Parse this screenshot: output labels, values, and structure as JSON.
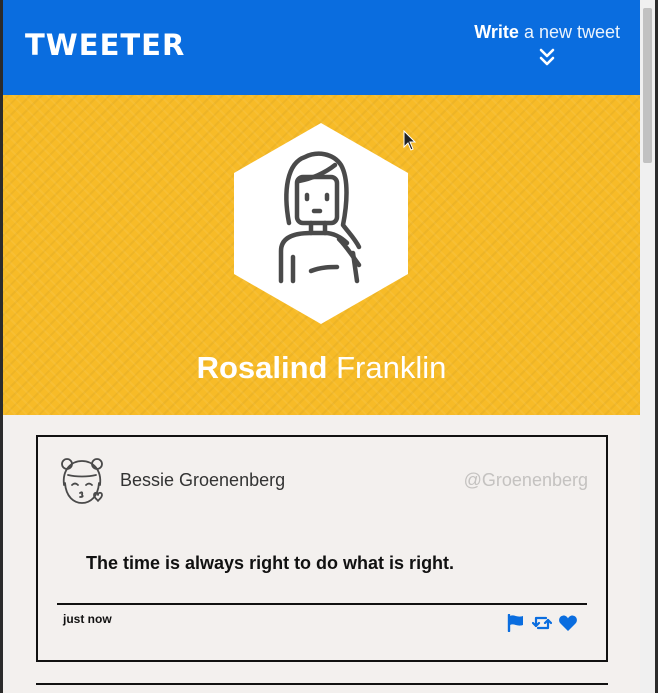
{
  "navbar": {
    "brand": "TWEETER",
    "compose_bold": "Write",
    "compose_rest": "a new tweet",
    "icon": "double-chevron-down-icon"
  },
  "profile": {
    "first_name": "Rosalind",
    "last_name": "Franklin",
    "avatar_icon": "woman-avatar-icon",
    "background_color": "#f7bb27"
  },
  "tweet": {
    "author": "Bessie Groenenberg",
    "handle": "@Groenenberg",
    "avatar_icon": "kissing-girl-avatar-icon",
    "text": "The time is always right to do what is right.",
    "timestamp": "just now",
    "actions": [
      "flag-icon",
      "retweet-icon",
      "heart-icon"
    ]
  },
  "colors": {
    "accent": "#0a6ddf",
    "banner": "#f7bb27",
    "page": "#f3f0ee"
  }
}
